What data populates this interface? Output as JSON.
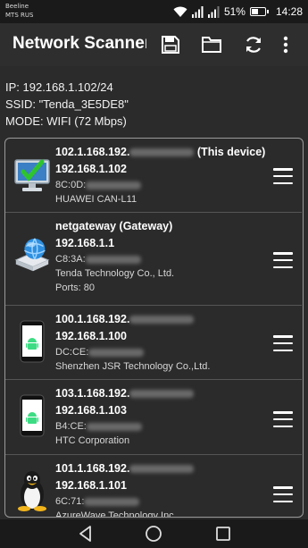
{
  "status": {
    "carrier1": "Beeline",
    "carrier2": "MTS RUS",
    "battery": "51%",
    "battery_level": 0.51,
    "time": "14:28"
  },
  "toolbar": {
    "title": "Network Scanner",
    "icons": [
      "save-icon",
      "folder-icon",
      "refresh-icon",
      "overflow-menu-icon"
    ]
  },
  "info": {
    "ip": "IP: 192.168.1.102/24",
    "ssid": "SSID: \"Tenda_3E5DE8\"",
    "mode": "MODE: WIFI (72 Mbps)"
  },
  "devices": [
    {
      "icon": "monitor-check-icon",
      "line1": "102.1.168.192.",
      "suffix": " (This device)",
      "ip": "192.168.1.102",
      "mac": "8C:0D:",
      "vendor": "HUAWEI CAN-L11",
      "extra": ""
    },
    {
      "icon": "router-globe-icon",
      "line1": "netgateway (Gateway)",
      "suffix": "",
      "ip": "192.168.1.1",
      "mac": "C8:3A:",
      "vendor": "Tenda Technology Co., Ltd.",
      "extra": "Ports: 80"
    },
    {
      "icon": "android-phone-icon",
      "line1": "100.1.168.192.",
      "suffix": "",
      "ip": "192.168.1.100",
      "mac": "DC:CE:",
      "vendor": "Shenzhen JSR Technology Co.,Ltd.",
      "extra": ""
    },
    {
      "icon": "android-phone-icon",
      "line1": "103.1.168.192.",
      "suffix": "",
      "ip": "192.168.1.103",
      "mac": "B4:CE:",
      "vendor": "HTC Corporation",
      "extra": ""
    },
    {
      "icon": "linux-penguin-icon",
      "line1": "101.1.168.192.",
      "suffix": "",
      "ip": "192.168.1.101",
      "mac": "6C:71:",
      "vendor": "AzureWave Technology Inc.",
      "extra": ""
    }
  ],
  "nav": [
    "back-icon",
    "home-icon",
    "recents-icon"
  ],
  "colors": {
    "background": "#2b2b2b",
    "toolbar": "#2e2e2e",
    "statusbar": "#1a1a1a",
    "list_border": "#9a9a9a"
  }
}
